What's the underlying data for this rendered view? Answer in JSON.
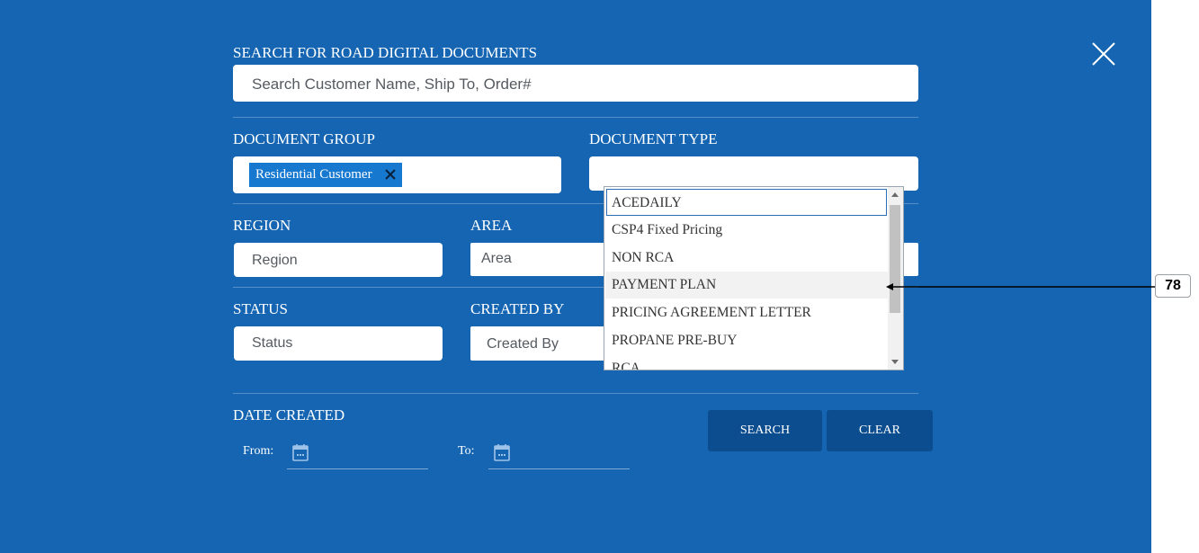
{
  "search": {
    "label": "SEARCH FOR ROAD DIGITAL DOCUMENTS",
    "placeholder": "Search Customer Name, Ship To, Order#"
  },
  "document_group": {
    "label": "DOCUMENT GROUP",
    "selected_chip": "Residential Customer"
  },
  "document_type": {
    "label": "DOCUMENT TYPE",
    "options": [
      "ACEDAILY",
      "CSP4 Fixed Pricing",
      "NON RCA",
      "PAYMENT PLAN",
      "PRICING AGREEMENT LETTER",
      "PROPANE PRE-BUY",
      "RCA"
    ],
    "highlighted": "PAYMENT PLAN"
  },
  "region": {
    "label": "REGION",
    "placeholder": "Region"
  },
  "area": {
    "label": "AREA",
    "placeholder": "Area"
  },
  "status": {
    "label": "STATUS",
    "placeholder": "Status"
  },
  "created_by": {
    "label": "CREATED BY",
    "placeholder": "Created By"
  },
  "date_created": {
    "label": "DATE CREATED",
    "from_label": "From:",
    "to_label": "To:"
  },
  "buttons": {
    "search": "SEARCH",
    "clear": "CLEAR"
  },
  "annotation": {
    "badge": "78"
  },
  "icons": {
    "close": "close-icon",
    "chip_remove": "remove-chip-icon",
    "calendar": "calendar-icon"
  },
  "colors": {
    "panel": "#1565b2",
    "button": "#0b4d8e",
    "chip": "#1778d0"
  }
}
